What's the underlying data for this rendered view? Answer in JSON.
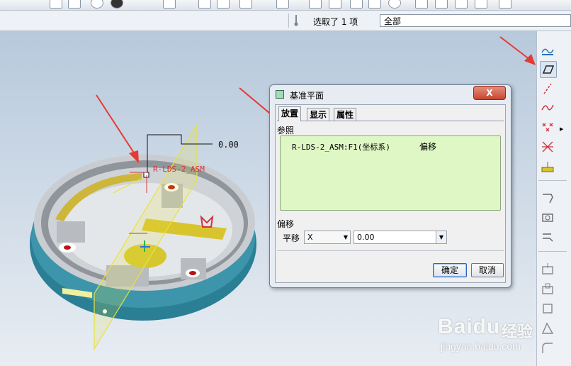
{
  "status": {
    "selection_text": "选取了 1 项",
    "filter_value": "全部"
  },
  "viewport": {
    "dimension_value": "0.00",
    "csys_label": "R-LDS-2_ASM"
  },
  "dialog": {
    "title": "基准平面",
    "close_label": "X",
    "tabs": [
      {
        "label": "放置",
        "active": true
      },
      {
        "label": "显示",
        "active": false
      },
      {
        "label": "属性",
        "active": false
      }
    ],
    "references_label": "参照",
    "reference": {
      "name": "R-LDS-2_ASM:F1(坐标系)",
      "constraint": "偏移"
    },
    "offset_label": "偏移",
    "translate_label": "平移",
    "offset_axis": "X",
    "offset_value": "0.00",
    "ok_label": "确定",
    "cancel_label": "取消"
  },
  "watermark": {
    "logo": "Baidu",
    "logo_cn": "经验",
    "url": "jingyan.baidu.com"
  },
  "colors": {
    "annotation_arrow": "#e53935",
    "reference_box": "#dff7c4",
    "part_body": "#2a7f95",
    "datum_plane": "#e8e23a",
    "csys": "#d0343f"
  }
}
